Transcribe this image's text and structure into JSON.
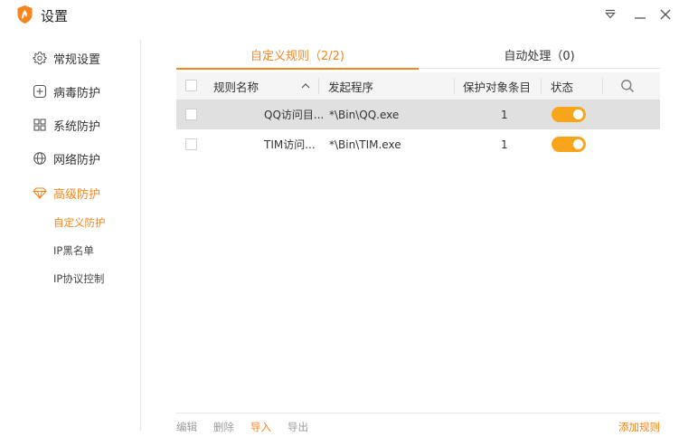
{
  "window": {
    "title": "设置",
    "accent_color": "#f5861f",
    "toggle_color": "#f9a51c"
  },
  "sidebar": {
    "items": [
      {
        "label": "常规设置",
        "icon": "gear-icon"
      },
      {
        "label": "病毒防护",
        "icon": "plus-box-icon"
      },
      {
        "label": "系统防护",
        "icon": "grid-icon"
      },
      {
        "label": "网络防护",
        "icon": "globe-icon"
      },
      {
        "label": "高级防护",
        "icon": "diamond-icon"
      }
    ],
    "subitems": [
      {
        "label": "自定义防护"
      },
      {
        "label": "IP黑名单"
      },
      {
        "label": "IP协议控制"
      }
    ]
  },
  "tabs": [
    {
      "label": "自定义规则（2/2)"
    },
    {
      "label": "自动处理（0)"
    }
  ],
  "table": {
    "headers": {
      "name": "规则名称",
      "program": "发起程序",
      "count": "保护对象条目",
      "status": "状态"
    },
    "rows": [
      {
        "name": "QQ访问目...",
        "program": "*\\Bin\\QQ.exe",
        "count": "1",
        "status_on": true,
        "selected": true
      },
      {
        "name": "TIM访问...",
        "program": "*\\Bin\\TIM.exe",
        "count": "1",
        "status_on": true,
        "selected": false
      }
    ]
  },
  "footer": {
    "edit": "编辑",
    "delete": "删除",
    "import": "导入",
    "export": "导出",
    "add_rule": "添加规则"
  }
}
